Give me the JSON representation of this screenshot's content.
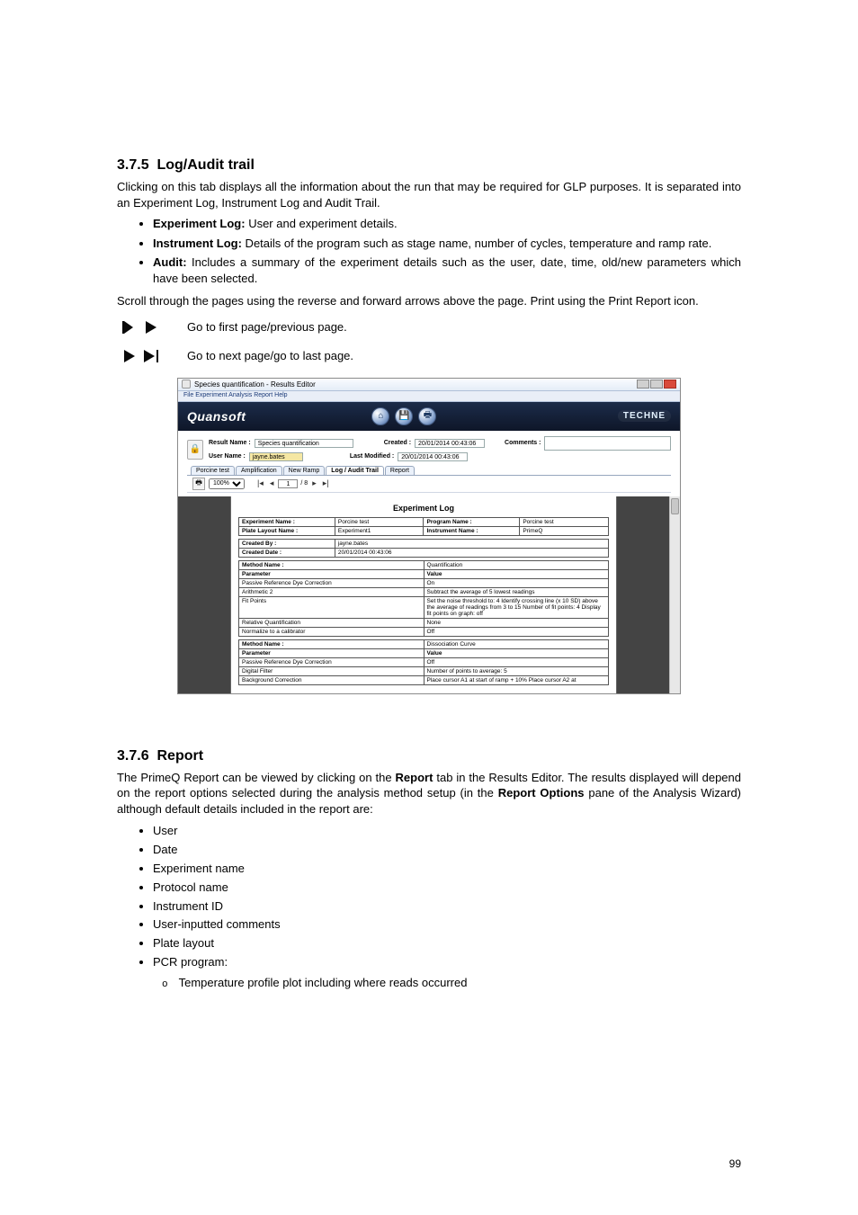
{
  "section1": {
    "number": "3.7.5",
    "title": "Log/Audit trail",
    "intro": "Clicking on this tab displays all the information about the run that may be required for GLP purposes. It is separated into an Experiment Log, Instrument Log and Audit Trail.",
    "bullets": [
      {
        "label": "Experiment Log:",
        "text": " User and experiment details."
      },
      {
        "label": "Instrument Log:",
        "text": " Details of the program such as stage name, number of cycles, temperature and ramp rate."
      },
      {
        "label": "Audit:",
        "text": " Includes a summary of the experiment details such as the user, date, time, old/new parameters which have been selected."
      }
    ],
    "scroll_hint": "Scroll through the pages using the reverse and forward arrows above the page. Print using the Print Report icon.",
    "nav_first_prev": "Go to first page/previous page.",
    "nav_next_last": "Go to next page/go to last page."
  },
  "screenshot": {
    "window_title": "Species quantification - Results Editor",
    "menubar": "File   Experiment   Analysis   Report   Help",
    "brand": "Quansoft",
    "techne": "TECHNE",
    "result_name_label": "Result Name :",
    "result_name_value": "Species quantification",
    "user_name_label": "User Name :",
    "user_name_value": "jayne.bates",
    "created_label": "Created :",
    "created_value": "20/01/2014 00:43:06",
    "lastmod_label": "Last Modified :",
    "lastmod_value": "20/01/2014 00:43:06",
    "comments_label": "Comments :",
    "tabs": [
      "Porcine test",
      "Amplification",
      "New Ramp",
      "Log / Audit Trail",
      "Report"
    ],
    "zoom": "100%",
    "page_of": "/ 8",
    "page_cur": "1",
    "report_heading": "Experiment Log",
    "kv_left": {
      "exp_name_l": "Experiment Name :",
      "exp_name_v": "Porcine test",
      "plate_l": "Plate Layout Name :",
      "plate_v": "Experiment1",
      "prog_l": "Program Name :",
      "prog_v": "Porcine test",
      "inst_l": "Instrument Name :",
      "inst_v": "PrimeQ",
      "createdby_l": "Created By :",
      "createdby_v": "jayne.bates",
      "createddate_l": "Created Date :",
      "createddate_v": "20/01/2014 00:43:06"
    },
    "method1": {
      "method_l": "Method Name :",
      "method_v": "Quantification",
      "param_h": "Parameter",
      "value_h": "Value",
      "rows": [
        [
          "Passive Reference Dye Correction",
          "On"
        ],
        [
          "Arithmetic 2",
          "Subtract the average of 5 lowest readings"
        ],
        [
          "Fit Points",
          "Set the noise threshold to: 4  Identify crossing line (x 10 SD) above the average of readings from 3 to 15  Number of fit points: 4  Display fit points on graph: off"
        ],
        [
          "Relative Quantification",
          "None"
        ],
        [
          "Normalize to a calibrator",
          "Off"
        ]
      ]
    },
    "method2": {
      "method_l": "Method Name :",
      "method_v": "Dissociation Curve",
      "param_h": "Parameter",
      "value_h": "Value",
      "rows": [
        [
          "Passive Reference Dye Correction",
          "Off"
        ],
        [
          "Digital Filter",
          "Number of points to average: 5"
        ],
        [
          "Background Correction",
          "Place cursor A1 at start of ramp + 10%   Place cursor A2 at"
        ]
      ]
    }
  },
  "section2": {
    "number": "3.7.6",
    "title": "Report",
    "para_parts": {
      "p1a": "The PrimeQ Report can be viewed by clicking on the ",
      "p1b": "Report",
      "p1c": " tab in the Results Editor. The results displayed will depend on the report options selected during the analysis method setup (in the ",
      "p1d": "Report Options",
      "p1e": " pane of the Analysis Wizard) although default details included in the report are:"
    },
    "items": [
      "User",
      "Date",
      "Experiment name",
      "Protocol name",
      "Instrument ID",
      "User-inputted comments",
      "Plate layout",
      "PCR program:"
    ],
    "subitem": "Temperature profile plot including where reads occurred"
  },
  "page_number": "99"
}
